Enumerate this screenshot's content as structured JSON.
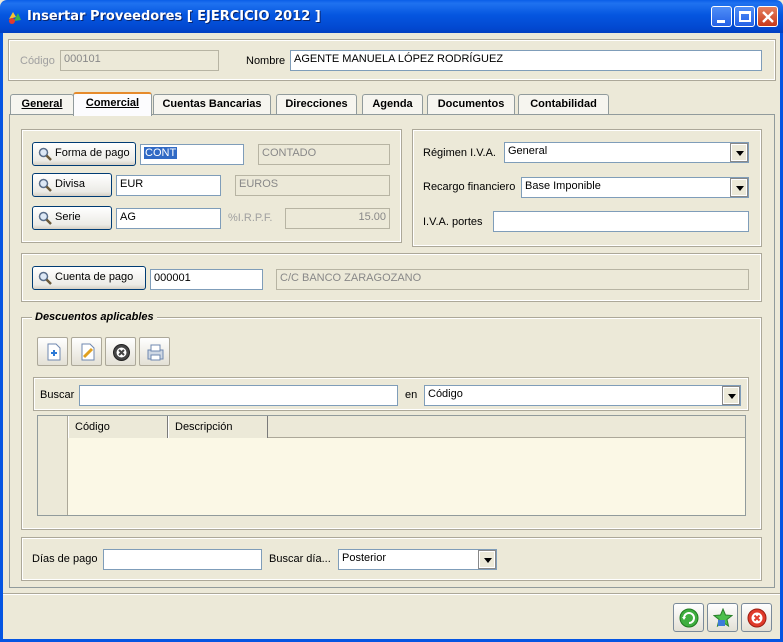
{
  "window": {
    "title": "Insertar Proveedores [ EJERCICIO 2012 ]"
  },
  "header": {
    "codigo_label": "Código",
    "codigo_value": "000101",
    "nombre_label": "Nombre",
    "nombre_value": "AGENTE MANUELA LÓPEZ RODRÍGUEZ"
  },
  "tabs": [
    {
      "label": "General"
    },
    {
      "label": "Comercial"
    },
    {
      "label": "Cuentas Bancarias"
    },
    {
      "label": "Direcciones"
    },
    {
      "label": "Agenda"
    },
    {
      "label": "Documentos"
    },
    {
      "label": "Contabilidad"
    }
  ],
  "comercial": {
    "forma_pago_button": "Forma de pago",
    "forma_pago_code": "CONT",
    "forma_pago_desc": "CONTADO",
    "divisa_button": "Divisa",
    "divisa_code": "EUR",
    "divisa_desc": "EUROS",
    "serie_button": "Serie",
    "serie_code": "AG",
    "irpf_label": "%I.R.P.F.",
    "irpf_value": "15.00",
    "regimen_label": "Régimen I.V.A.",
    "regimen_value": "General",
    "recargo_label": "Recargo financiero",
    "recargo_value": "Base Imponible",
    "iva_portes_label": "I.V.A. portes",
    "iva_portes_value": "",
    "cuenta_pago_button": "Cuenta de pago",
    "cuenta_pago_code": "000001",
    "cuenta_pago_desc": "C/C BANCO ZARAGOZANO"
  },
  "descuentos": {
    "title": "Descuentos aplicables",
    "buscar_label": "Buscar",
    "buscar_value": "",
    "en_label": "en",
    "en_value": "Código",
    "columns": [
      "Código",
      "Descripción"
    ],
    "rows": []
  },
  "footer": {
    "dias_label": "Días de pago",
    "dias_value": "",
    "buscar_dia_label": "Buscar día...",
    "buscar_dia_value": "Posterior"
  },
  "icons": [
    "app-icon",
    "minimize-icon",
    "maximize-icon",
    "close-icon",
    "magnifier-icon",
    "add-document-icon",
    "edit-document-icon",
    "delete-icon",
    "print-icon",
    "refresh-icon",
    "save-icon",
    "cancel-icon"
  ]
}
